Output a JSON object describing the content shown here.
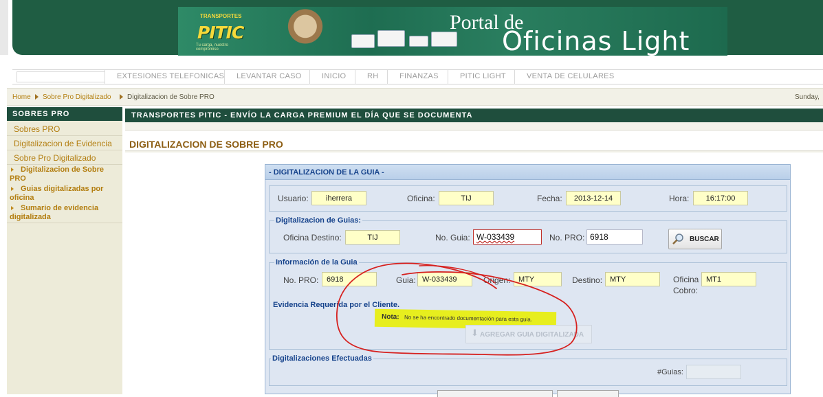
{
  "banner": {
    "logo_name": "PITIC",
    "logo_small": "TRANSPORTES",
    "logo_tagline": "Tu carga, nuestro compromiso",
    "title_line1": "Portal de",
    "title_line2": "Oficinas Light"
  },
  "nav": {
    "items": [
      "EXTESIONES TELEFONICAS",
      "LEVANTAR CASO",
      "INICIO",
      "RH",
      "FINANZAS",
      "PITIC LIGHT",
      "VENTA DE CELULARES"
    ]
  },
  "breadcrumb": {
    "items": [
      "Home",
      "Sobre Pro Digitalizado",
      "Digitalizacion de Sobre PRO"
    ],
    "date": "Sunday,"
  },
  "sidebar": {
    "header": "SOBRES PRO",
    "links": [
      "Sobres PRO",
      "Digitalizacion de Evidencia",
      "Sobre Pro Digitalizado"
    ],
    "subitems": [
      "Digitalizacion de Sobre PRO",
      "Guias digitalizadas por oficina",
      "Sumario de evidencia digitalizada"
    ]
  },
  "main": {
    "header": "TRANSPORTES PITIC - ENVÍO LA CARGA PREMIUM EL DÍA QUE SE DOCUMENTA",
    "page_title": "DIGITALIZACION DE SOBRE PRO"
  },
  "panel": {
    "title": "- DIGITALIZACION DE LA GUIA -",
    "usuario_label": "Usuario:",
    "usuario_value": "iherrera",
    "oficina_label": "Oficina:",
    "oficina_value": "TIJ",
    "fecha_label": "Fecha:",
    "fecha_value": "2013-12-14",
    "hora_label": "Hora:",
    "hora_value": "16:17:00",
    "dig_legend": "Digitalizacion de Guias:",
    "ofi_destino_label": "Oficina Destino:",
    "ofi_destino_value": "TIJ",
    "no_guia_label": "No. Guia:",
    "no_guia_value": "W-033439",
    "no_pro_label": "No. PRO:",
    "no_pro_value": "6918",
    "buscar_label": "BUSCAR",
    "info_legend": "Información de la Guia",
    "info_pro_label": "No. PRO:",
    "info_pro_value": "6918",
    "info_guia_label": "Guia:",
    "info_guia_value": "W-033439",
    "origen_label": "Origen:",
    "origen_value": "MTY",
    "destino_label": "Destino:",
    "destino_value": "MTY",
    "ofi_cobro_label1": "Oficina",
    "ofi_cobro_label2": "Cobro:",
    "ofi_cobro_value": "MT1",
    "evidencia_label": "Evidencia Requerida por el Cliente.",
    "nota_label": "Nota:",
    "nota_text": "No se ha encontrado documentación para esta guia.",
    "agregar_label": "AGREGAR GUIA DIGITALIZADA",
    "efectuadas_legend": "Digitalizaciones Efectuadas",
    "num_guias_label": "#Guias:",
    "num_guias_value": ""
  },
  "colors": {
    "dark_green": "#1f4e3d",
    "gold_link": "#b37e10",
    "panel_blue": "#15428b",
    "highlight": "#e8f01a",
    "annotation_red": "#d6211f"
  }
}
